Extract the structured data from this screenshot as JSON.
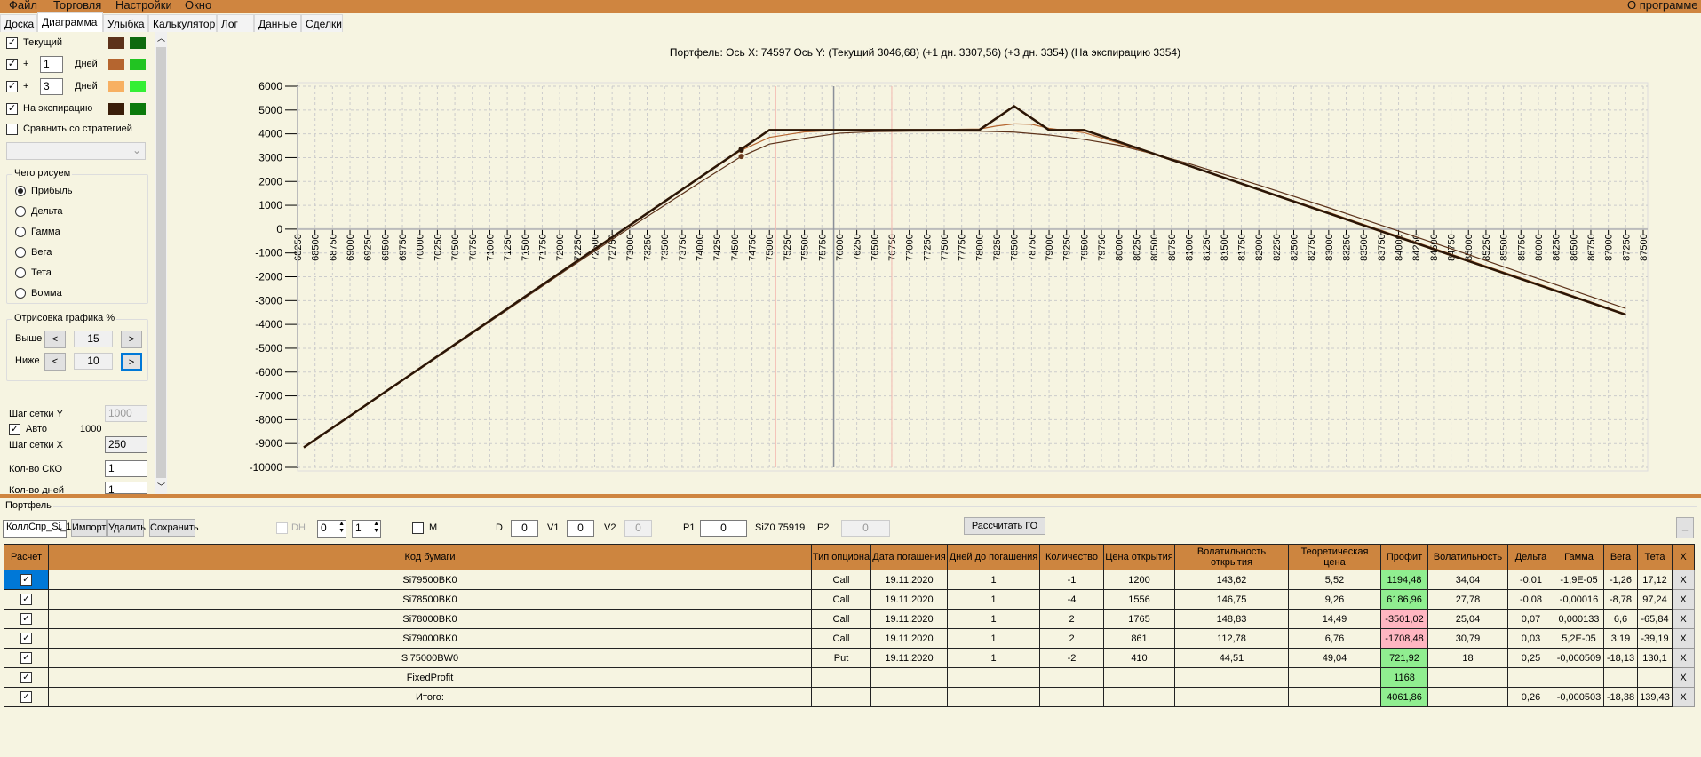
{
  "menu": {
    "items": [
      "Файл",
      "Торговля",
      "Настройки",
      "Окно"
    ],
    "about": "О программе"
  },
  "tabs": [
    "Доска",
    "Диаграмма",
    "Улыбка",
    "Калькулятор",
    "Лог",
    "Данные",
    "Сделки"
  ],
  "active_tab": "Диаграмма",
  "left": {
    "current": {
      "label": "Текущий",
      "checked": true,
      "colors": [
        "#5c321a",
        "#0e6a0e"
      ]
    },
    "plus1": {
      "plus": "+",
      "value": "1",
      "unit": "Дней",
      "checked": true,
      "colors": [
        "#b5652f",
        "#22c422"
      ]
    },
    "plus3": {
      "plus": "+",
      "value": "3",
      "unit": "Дней",
      "checked": true,
      "colors": [
        "#f7b062",
        "#34ef34"
      ]
    },
    "expiration": {
      "label": "На экспирацию",
      "checked": true,
      "colors": [
        "#3a1e0a",
        "#0b7a0b"
      ]
    },
    "compare": {
      "label": "Сравнить со стратегией",
      "checked": false
    },
    "draw_group": "Чего рисуем",
    "draw_options": [
      "Прибыль",
      "Дельта",
      "Гамма",
      "Вега",
      "Тета",
      "Вомма"
    ],
    "draw_selected": "Прибыль",
    "range_group": "Отрисовка графика %",
    "above": {
      "label": "Выше",
      "value": "15",
      "dec": "<",
      "inc": ">"
    },
    "below": {
      "label": "Ниже",
      "value": "10",
      "dec": "<",
      "inc": ">"
    },
    "grid_y": {
      "label": "Шаг сетки Y",
      "value": "1000"
    },
    "auto": {
      "label": "Авто",
      "checked": true,
      "value": "1000"
    },
    "grid_x": {
      "label": "Шаг сетки X",
      "value": "250"
    },
    "sko": {
      "label": "Кол-во СКО",
      "value": "1"
    },
    "days": {
      "label": "Кол-во дней",
      "value": "1"
    }
  },
  "chart_data": {
    "type": "line",
    "title": "Портфель: Ось X: 74597 Ось Y:  (Текущий 3046,68)  (+1 дн. 3307,56)  (+3 дн. 3354)  (На экспирацию 3354)",
    "xlim": [
      68250,
      87500
    ],
    "ylim": [
      -10000,
      6000
    ],
    "xstep": 250,
    "ystep": 1000,
    "grid": true,
    "cursor_x": 74597,
    "vlines": {
      "underlying": 75919,
      "sko_low": 75090,
      "sko_high": 76750
    },
    "series": [
      {
        "name": "Текущий",
        "color": "#5c321a",
        "points": [
          [
            68339,
            -9170
          ],
          [
            72000,
            -1900
          ],
          [
            73000,
            50
          ],
          [
            74000,
            1950
          ],
          [
            74597,
            3047
          ],
          [
            75000,
            3570
          ],
          [
            75500,
            3810
          ],
          [
            76000,
            4025
          ],
          [
            76500,
            4090
          ],
          [
            77000,
            4110
          ],
          [
            77500,
            4115
          ],
          [
            78000,
            4110
          ],
          [
            78500,
            4070
          ],
          [
            79000,
            3950
          ],
          [
            79500,
            3765
          ],
          [
            80000,
            3520
          ],
          [
            80500,
            3150
          ],
          [
            81000,
            2750
          ],
          [
            82000,
            1850
          ],
          [
            83000,
            900
          ],
          [
            84000,
            -80
          ],
          [
            85000,
            -1070
          ],
          [
            86000,
            -2080
          ],
          [
            87250,
            -3330
          ]
        ]
      },
      {
        "name": "+1 дн.",
        "color": "#b5652f",
        "points": [
          [
            68339,
            -9162
          ],
          [
            72000,
            -1840
          ],
          [
            73000,
            150
          ],
          [
            74000,
            2140
          ],
          [
            74597,
            3308
          ],
          [
            75000,
            3850
          ],
          [
            75500,
            4080
          ],
          [
            76000,
            4150
          ],
          [
            77000,
            4160
          ],
          [
            78000,
            4200
          ],
          [
            78250,
            4330
          ],
          [
            78500,
            4420
          ],
          [
            78750,
            4400
          ],
          [
            79000,
            4230
          ],
          [
            79500,
            4050
          ],
          [
            80000,
            3600
          ],
          [
            80500,
            3130
          ],
          [
            81000,
            2650
          ],
          [
            82000,
            1680
          ],
          [
            83000,
            700
          ],
          [
            84000,
            -300
          ],
          [
            85000,
            -1300
          ],
          [
            86000,
            -2300
          ],
          [
            87250,
            -3560
          ]
        ]
      },
      {
        "name": "+3 дн.",
        "color": "#f7b062",
        "points": [
          [
            68339,
            -9162
          ],
          [
            75000,
            4160
          ],
          [
            78000,
            4160
          ],
          [
            78500,
            5160
          ],
          [
            79000,
            4160
          ],
          [
            79500,
            4160
          ],
          [
            87250,
            -3590
          ]
        ]
      },
      {
        "name": "На экспирацию",
        "color": "#2a1608",
        "points": [
          [
            68339,
            -9162
          ],
          [
            75000,
            4160
          ],
          [
            78000,
            4160
          ],
          [
            78500,
            5160
          ],
          [
            79000,
            4160
          ],
          [
            79500,
            4160
          ],
          [
            87250,
            -3590
          ]
        ]
      }
    ]
  },
  "portfolio": {
    "title": "Портфель",
    "combo": "КоллСпр_Si_1",
    "import": "Импорт",
    "delete": "Удалить",
    "save": "Сохранить",
    "dh": "DH",
    "spin1": "0",
    "spin2": "1",
    "m": "M",
    "d_label": "D",
    "d_value": "0",
    "v1_label": "V1",
    "v1_value": "0",
    "v2_label": "V2",
    "v2_value": "0",
    "p1_label": "P1",
    "p1_value": "0",
    "underlying": "SiZ0 75919",
    "p2_label": "P2",
    "p2_value": "0",
    "calc_go": "Рассчитать ГО",
    "minimize": "_"
  },
  "table": {
    "headers": [
      "Расчет",
      "Код бумаги",
      "Тип опциона",
      "Дата погашения",
      "Дней до погашения",
      "Количество",
      "Цена открытия",
      "Волатильность открытия",
      "Теоретическая цена",
      "Профит",
      "Волатильность",
      "Дельта",
      "Гамма",
      "Вега",
      "Тета",
      "X"
    ],
    "rows": [
      [
        "Si79500BK0",
        "Call",
        "19.11.2020",
        "1",
        "-1",
        "1200",
        "143,62",
        "5,52",
        "1194,48",
        "34,04",
        "-0,01",
        "-1,9E-05",
        "-1,26",
        "17,12",
        "X"
      ],
      [
        "Si78500BK0",
        "Call",
        "19.11.2020",
        "1",
        "-4",
        "1556",
        "146,75",
        "9,26",
        "6186,96",
        "27,78",
        "-0,08",
        "-0,00016",
        "-8,78",
        "97,24",
        "X"
      ],
      [
        "Si78000BK0",
        "Call",
        "19.11.2020",
        "1",
        "2",
        "1765",
        "148,83",
        "14,49",
        "-3501,02",
        "25,04",
        "0,07",
        "0,000133",
        "6,6",
        "-65,84",
        "X"
      ],
      [
        "Si79000BK0",
        "Call",
        "19.11.2020",
        "1",
        "2",
        "861",
        "112,78",
        "6,76",
        "-1708,48",
        "30,79",
        "0,03",
        "5,2E-05",
        "3,19",
        "-39,19",
        "X"
      ],
      [
        "Si75000BW0",
        "Put",
        "19.11.2020",
        "1",
        "-2",
        "410",
        "44,51",
        "49,04",
        "721,92",
        "18",
        "0,25",
        "-0,000509",
        "-18,13",
        "130,1",
        "X"
      ],
      [
        "FixedProfit",
        "",
        "",
        "",
        "",
        "",
        "",
        "",
        "1168",
        "",
        "",
        "",
        "",
        "",
        "X"
      ],
      [
        "Итого:",
        "",
        "",
        "",
        "",
        "",
        "",
        "",
        "4061,86",
        "",
        "0,26",
        "-0,000503",
        "-18,38",
        "139,43",
        "X"
      ]
    ],
    "profit_colors": {
      "positive": "#90ee90",
      "negative": "#ffb6c1"
    }
  }
}
